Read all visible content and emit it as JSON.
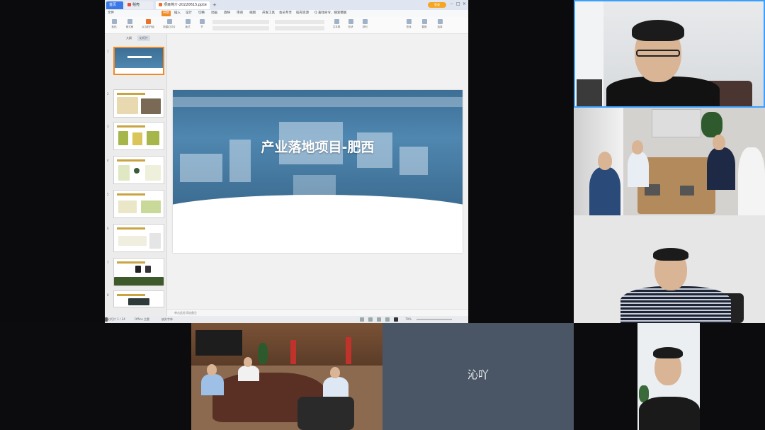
{
  "share": {
    "tabs": {
      "home": "首页",
      "doc2": "稻壳",
      "active": "项目简介-20220615.pptx"
    },
    "login_badge": "登录",
    "menu": [
      "文件",
      "开始",
      "插入",
      "设计",
      "切换",
      "动画",
      "放映",
      "审阅",
      "视图",
      "开发工具",
      "会员专享",
      "稻壳资源",
      "Q 查找命令、搜索模板"
    ],
    "menu_selected": "开始",
    "ribbon_buttons": [
      "粘贴",
      "格式刷",
      "从当前开始",
      "新建幻灯片",
      "版式",
      "节",
      "字体",
      "段落",
      "文本框",
      "形状",
      "排列",
      "查找",
      "替换",
      "选择"
    ],
    "thumb_tabs": [
      "大纲",
      "幻灯片"
    ],
    "thumb_tab_selected": "幻灯片",
    "slide_numbers": [
      "1",
      "2",
      "3",
      "4",
      "5",
      "6",
      "7",
      "8"
    ],
    "slide_title": "产业落地项目-肥西",
    "notes_placeholder": "单击此处添加备注",
    "status": {
      "slide_info": "幻灯片 1 / 24",
      "theme": "Office 主题",
      "missing_font": "缺失字体",
      "zoom": "79%"
    }
  },
  "participants": {
    "tile5_name": "沁吖"
  },
  "colors": {
    "active_speaker_border": "#3aa0ff",
    "menu_accent": "#f08a24",
    "slide_banner": "#4f87b0"
  }
}
